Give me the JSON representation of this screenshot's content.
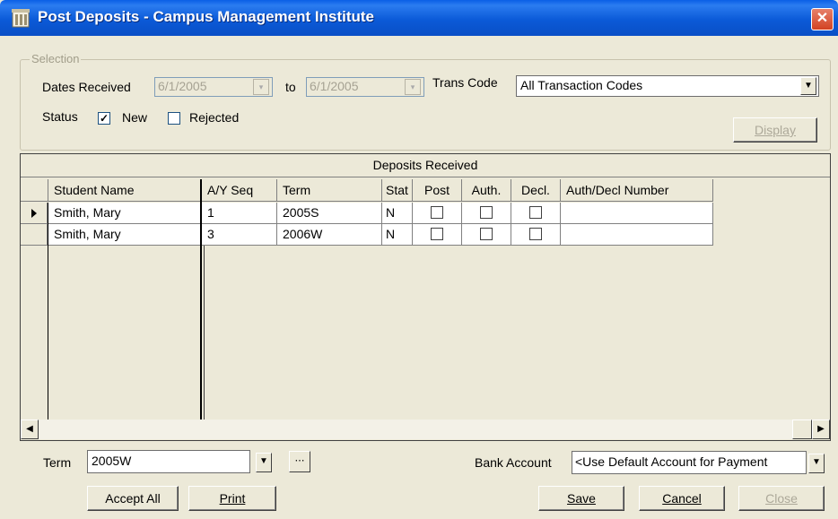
{
  "window": {
    "title": "Post Deposits - Campus Management Institute",
    "close_glyph": "✕"
  },
  "selection": {
    "legend": "Selection",
    "dates_received_label": "Dates Received",
    "date_from": "6/1/2005",
    "to_label": "to",
    "date_to": "6/1/2005",
    "trans_code_label": "Trans Code",
    "trans_code_value": "All Transaction Codes",
    "status_label": "Status",
    "new_label": "New",
    "new_checked": true,
    "rejected_label": "Rejected",
    "rejected_checked": false,
    "display_button": "Display"
  },
  "grid": {
    "caption": "Deposits Received",
    "columns": [
      "Student Name",
      "A/Y Seq",
      "Term",
      "Stat",
      "Post",
      "Auth.",
      "Decl.",
      "Auth/Decl Number"
    ],
    "rows": [
      {
        "student_name": "Smith, Mary",
        "ay_seq": "1",
        "term": "2005S",
        "stat": "N",
        "post": false,
        "auth": false,
        "decl": false,
        "auth_decl_number": "",
        "selected": true
      },
      {
        "student_name": "Smith, Mary",
        "ay_seq": "3",
        "term": "2006W",
        "stat": "N",
        "post": false,
        "auth": false,
        "decl": false,
        "auth_decl_number": "",
        "selected": false
      }
    ]
  },
  "footer": {
    "term_label": "Term",
    "term_value": "2005W",
    "bank_account_label": "Bank Account",
    "bank_account_value": "<Use Default Account for Payment",
    "accept_all_button": "Accept All",
    "print_button": "Print",
    "save_button": "Save",
    "cancel_button": "Cancel",
    "close_button": "Close"
  },
  "icons": [
    "app-icon",
    "close-icon",
    "dropdown-arrow-icon",
    "record-pointer-icon",
    "ellipsis-icon"
  ]
}
